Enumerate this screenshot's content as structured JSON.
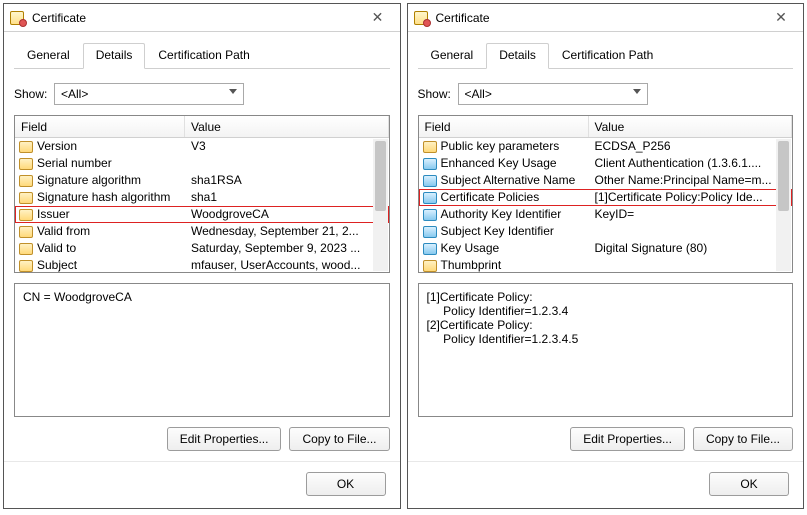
{
  "window": {
    "title": "Certificate",
    "close_label": "✕"
  },
  "tabs": {
    "general": "General",
    "details": "Details",
    "certpath": "Certification Path"
  },
  "show": {
    "label": "Show:",
    "selected": "<All>"
  },
  "list": {
    "hdr_field": "Field",
    "hdr_value": "Value"
  },
  "buttons": {
    "edit_props": "Edit Properties...",
    "copy_file": "Copy to File...",
    "ok": "OK"
  },
  "left": {
    "rows": [
      {
        "f": "Version",
        "v": "V3"
      },
      {
        "f": "Serial number",
        "v": ""
      },
      {
        "f": "Signature algorithm",
        "v": "sha1RSA"
      },
      {
        "f": "Signature hash algorithm",
        "v": "sha1"
      },
      {
        "f": "Issuer",
        "v": "WoodgroveCA"
      },
      {
        "f": "Valid from",
        "v": "Wednesday, September 21, 2..."
      },
      {
        "f": "Valid to",
        "v": "Saturday, September 9, 2023 ..."
      },
      {
        "f": "Subject",
        "v": "mfauser, UserAccounts, wood..."
      }
    ],
    "highlight_index": 4,
    "detail": "CN = WoodgroveCA"
  },
  "right": {
    "rows": [
      {
        "f": "Public key parameters",
        "v": "ECDSA_P256"
      },
      {
        "f": "Enhanced Key Usage",
        "v": "Client Authentication (1.3.6.1....",
        "ext": true
      },
      {
        "f": "Subject Alternative Name",
        "v": "Other Name:Principal Name=m...",
        "ext": true
      },
      {
        "f": "Certificate Policies",
        "v": "[1]Certificate Policy:Policy Ide...",
        "ext": true
      },
      {
        "f": "Authority Key Identifier",
        "v": "KeyID=",
        "ext": true
      },
      {
        "f": "Subject Key Identifier",
        "v": "",
        "ext": true
      },
      {
        "f": "Key Usage",
        "v": "Digital Signature (80)",
        "ext": true
      },
      {
        "f": "Thumbprint",
        "v": ""
      }
    ],
    "highlight_index": 3,
    "detail": "[1]Certificate Policy:\n     Policy Identifier=1.2.3.4\n[2]Certificate Policy:\n     Policy Identifier=1.2.3.4.5"
  }
}
